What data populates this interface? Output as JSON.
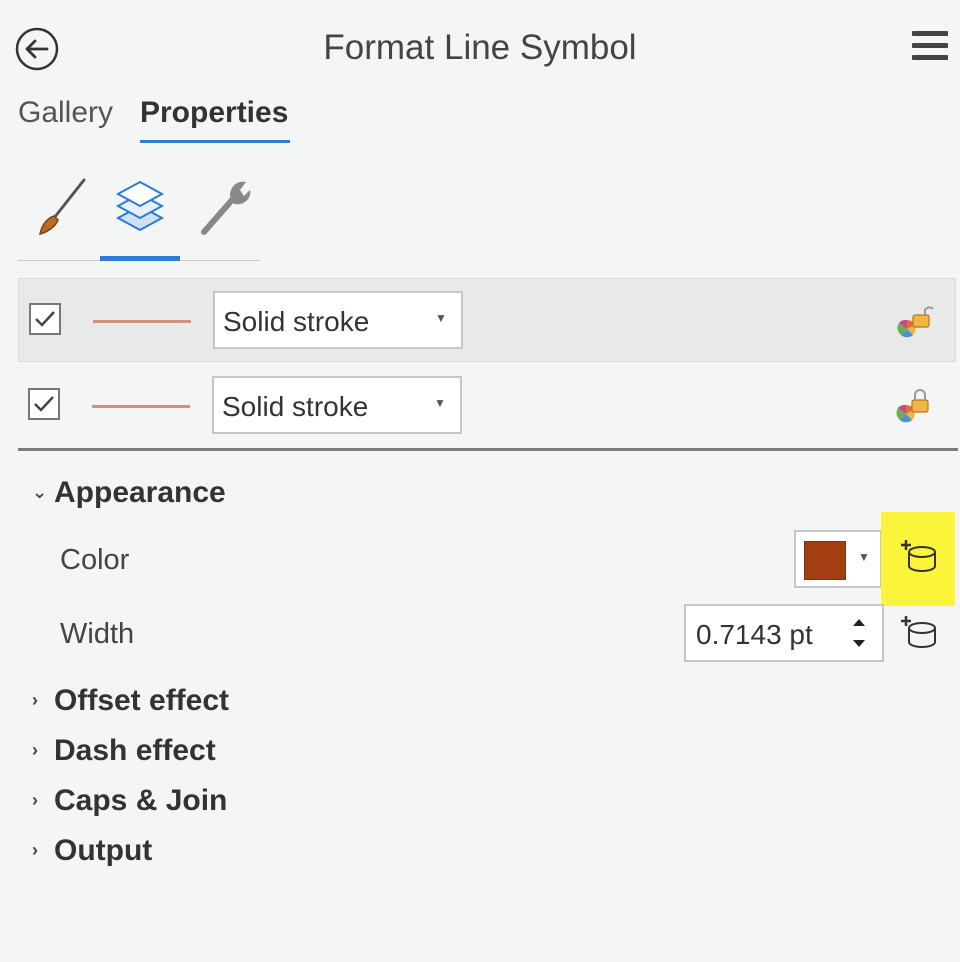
{
  "header": {
    "title": "Format Line Symbol",
    "back_icon": "back-arrow-icon",
    "menu_icon": "hamburger-menu-icon"
  },
  "tabs": [
    {
      "label": "Gallery",
      "active": false
    },
    {
      "label": "Properties",
      "active": true
    }
  ],
  "subtabs": [
    {
      "icon": "paintbrush-icon",
      "active": false
    },
    {
      "icon": "layers-icon",
      "active": true
    },
    {
      "icon": "wrench-icon",
      "active": false
    }
  ],
  "layers": [
    {
      "checked": true,
      "type": "Solid stroke",
      "stroke_color": "#d3917a",
      "lock": "unlocked",
      "selected": true
    },
    {
      "checked": true,
      "type": "Solid stroke",
      "stroke_color": "#d3917a",
      "lock": "locked",
      "selected": false
    }
  ],
  "appearance": {
    "heading": "Appearance",
    "expanded": true,
    "color_label": "Color",
    "color_value": "#a33d12",
    "width_label": "Width",
    "width_value": "0.7143 pt"
  },
  "sections": [
    {
      "label": "Offset effect",
      "expanded": false
    },
    {
      "label": "Dash effect",
      "expanded": false
    },
    {
      "label": "Caps & Join",
      "expanded": false
    },
    {
      "label": "Output",
      "expanded": false
    }
  ],
  "colors": {
    "accent": "#2d7bd4",
    "highlight": "#faf53a",
    "background": "#f4f5f5"
  }
}
